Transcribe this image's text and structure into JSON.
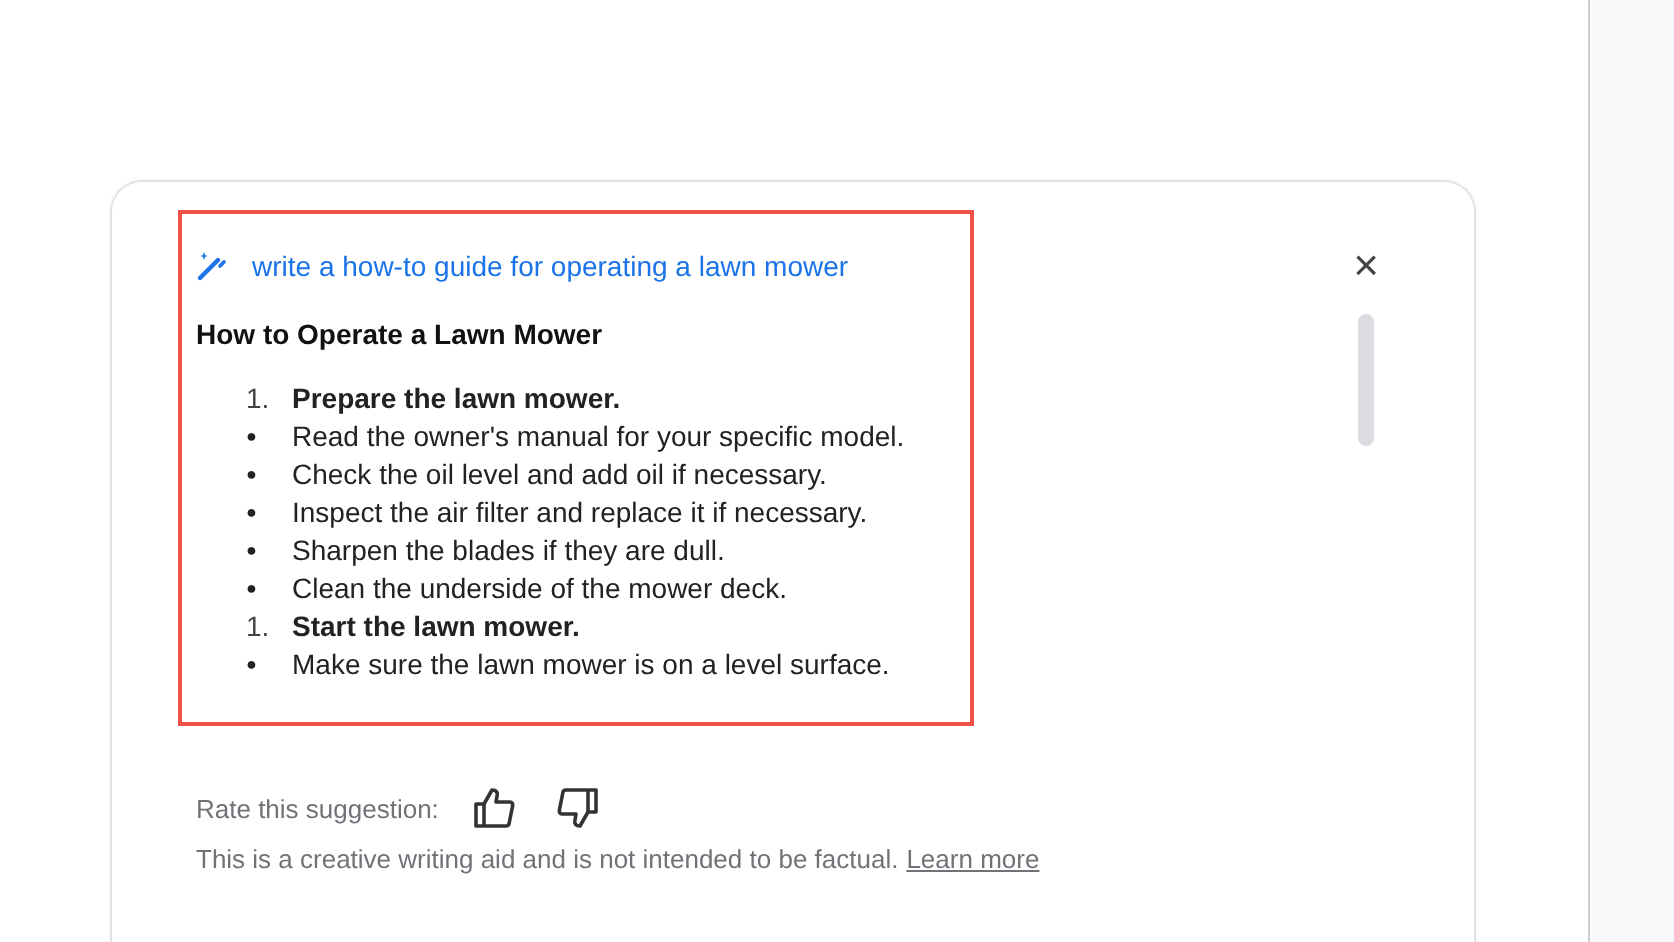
{
  "prompt": {
    "text": "write a how-to guide for operating a lawn mower"
  },
  "guide": {
    "title": "How to Operate a Lawn Mower",
    "items": [
      {
        "kind": "numbered",
        "marker": "1.",
        "text": "Prepare the lawn mower."
      },
      {
        "kind": "bullet",
        "marker": "●",
        "text": "Read the owner's manual for your specific model."
      },
      {
        "kind": "bullet",
        "marker": "●",
        "text": "Check the oil level and add oil if necessary."
      },
      {
        "kind": "bullet",
        "marker": "●",
        "text": "Inspect the air filter and replace it if necessary."
      },
      {
        "kind": "bullet",
        "marker": "●",
        "text": "Sharpen the blades if they are dull."
      },
      {
        "kind": "bullet",
        "marker": "●",
        "text": "Clean the underside of the mower deck."
      },
      {
        "kind": "numbered",
        "marker": "1.",
        "text": "Start the lawn mower."
      },
      {
        "kind": "bullet",
        "marker": "●",
        "text": "Make sure the lawn mower is on a level surface."
      }
    ]
  },
  "close": {
    "label": "×"
  },
  "rating": {
    "label": "Rate this suggestion:"
  },
  "disclaimer": {
    "text": "This is a creative writing aid and is not intended to be factual.",
    "link": "Learn more"
  }
}
